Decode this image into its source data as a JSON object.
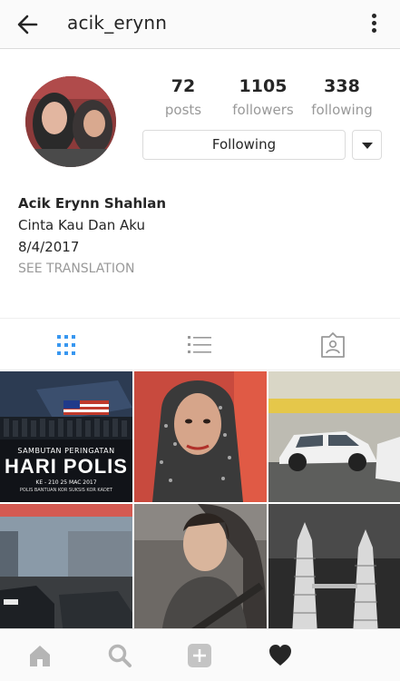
{
  "header": {
    "username": "acik_erynn"
  },
  "profile": {
    "posts_count": "72",
    "posts_label": "posts",
    "followers_count": "1105",
    "followers_label": "followers",
    "following_count": "338",
    "following_label": "following",
    "follow_button_label": "Following"
  },
  "bio": {
    "full_name": "Acik Erynn Shahlan",
    "line1": "Cinta Kau Dan Aku",
    "line2": "8/4/2017",
    "translate_label": "SEE TRANSLATION"
  },
  "tabs": [
    {
      "name": "grid",
      "icon": "grid-icon",
      "active": true
    },
    {
      "name": "list",
      "icon": "list-icon",
      "active": false
    },
    {
      "name": "tagged",
      "icon": "tagged-icon",
      "active": false
    }
  ],
  "posts": {
    "tile1": {
      "line1": "SAMBUTAN PERINGATAN",
      "line2": "HARI POLIS",
      "line3": "KE - 210    25 MAC 2017",
      "line4": "POLIS BANTUAN KOR SUKSIS KOR KADET"
    }
  },
  "nav": [
    "home-icon",
    "search-icon",
    "add-icon",
    "heart-icon"
  ],
  "colors": {
    "accent": "#3897f0",
    "text": "#262626",
    "muted": "#999999",
    "border": "#dbdbdb"
  }
}
